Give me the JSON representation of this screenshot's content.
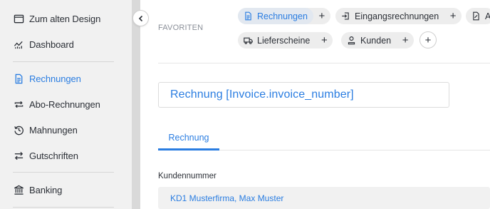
{
  "sidebar": {
    "items": [
      {
        "label": "Zum alten Design",
        "icon": "window-icon",
        "active": false
      },
      {
        "label": "Dashboard",
        "icon": "chart-icon",
        "active": false
      },
      {
        "label": "Rechnungen",
        "icon": "document-icon",
        "active": true
      },
      {
        "label": "Abo-Rechnungen",
        "icon": "repeat-icon",
        "active": false
      },
      {
        "label": "Mahnungen",
        "icon": "history-icon",
        "active": false
      },
      {
        "label": "Gutschriften",
        "icon": "exchange-icon",
        "active": false
      },
      {
        "label": "Banking",
        "icon": "bank-icon",
        "active": false
      }
    ]
  },
  "favorites": {
    "label": "FAVORITEN",
    "chips": [
      {
        "label": "Rechnungen",
        "icon": "document-icon",
        "active": true
      },
      {
        "label": "Eingangsrechnungen",
        "icon": "import-icon",
        "active": false
      },
      {
        "label": "An",
        "icon": "file-icon",
        "active": false
      },
      {
        "label": "Lieferscheine",
        "icon": "truck-icon",
        "active": false
      },
      {
        "label": "Kunden",
        "icon": "user-icon",
        "active": false
      }
    ],
    "add_symbol": "+"
  },
  "document": {
    "title": "Rechnung [Invoice.invoice_number]"
  },
  "tabs": [
    {
      "label": "Rechnung",
      "active": true
    }
  ],
  "fields": {
    "customer_number_label": "Kundennummer",
    "customer_number_value": "KD1 Musterfirma, Max Muster"
  },
  "colors": {
    "accent": "#2a7de1",
    "sidebar_bg": "#f1f1f1",
    "text": "#2b2f36",
    "muted": "#8a8f98"
  }
}
